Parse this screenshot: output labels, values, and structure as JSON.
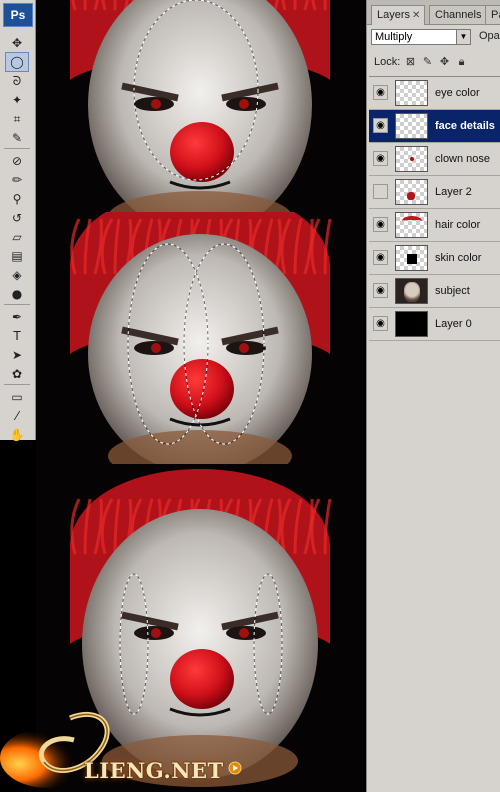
{
  "app": {
    "logo": "Ps"
  },
  "toolbar": {
    "tools": [
      {
        "name": "move-tool",
        "glyph": "✥"
      },
      {
        "name": "elliptical-marquee-tool",
        "glyph": "◯",
        "active": true
      },
      {
        "name": "lasso-tool",
        "glyph": "ᘐ"
      },
      {
        "name": "magic-wand-tool",
        "glyph": "✦"
      },
      {
        "name": "crop-tool",
        "glyph": "⌗"
      },
      {
        "name": "eyedropper-tool",
        "glyph": "✎"
      },
      {
        "name": "healing-brush-tool",
        "glyph": "⊘"
      },
      {
        "name": "brush-tool",
        "glyph": "✏"
      },
      {
        "name": "clone-stamp-tool",
        "glyph": "⚲"
      },
      {
        "name": "history-brush-tool",
        "glyph": "↺"
      },
      {
        "name": "eraser-tool",
        "glyph": "▱"
      },
      {
        "name": "gradient-tool",
        "glyph": "▤"
      },
      {
        "name": "blur-tool",
        "glyph": "◈"
      },
      {
        "name": "dodge-tool",
        "glyph": "●"
      },
      {
        "name": "pen-tool",
        "glyph": "✒"
      },
      {
        "name": "type-tool",
        "glyph": "T"
      },
      {
        "name": "path-selection-tool",
        "glyph": "➤"
      },
      {
        "name": "custom-shape-tool",
        "glyph": "✿"
      },
      {
        "name": "notes-tool",
        "glyph": "▭"
      },
      {
        "name": "color-sampler-tool",
        "glyph": "⁄"
      },
      {
        "name": "hand-tool",
        "glyph": "✋"
      }
    ]
  },
  "layers_panel": {
    "tabs": [
      {
        "label": "Layers",
        "active": true,
        "closable": true
      },
      {
        "label": "Channels",
        "active": false,
        "closable": false
      },
      {
        "label": "Pa",
        "active": false,
        "closable": false
      }
    ],
    "blend_mode": "Multiply",
    "opacity_label": "Opac",
    "lock_label": "Lock:",
    "lock_icons": [
      "transparent-pixels-lock-icon",
      "brush-lock-icon",
      "move-lock-icon",
      "padlock-icon"
    ],
    "layers": [
      {
        "name": "eye color",
        "visible": true,
        "selected": false,
        "thumb": "transparent"
      },
      {
        "name": "face details",
        "visible": true,
        "selected": true,
        "thumb": "transparent"
      },
      {
        "name": "clown nose",
        "visible": true,
        "selected": false,
        "thumb": "nose"
      },
      {
        "name": "Layer 2",
        "visible": false,
        "selected": false,
        "thumb": "red-spot"
      },
      {
        "name": "hair color",
        "visible": true,
        "selected": false,
        "thumb": "hair"
      },
      {
        "name": "skin color",
        "visible": true,
        "selected": false,
        "thumb": "square"
      },
      {
        "name": "subject",
        "visible": true,
        "selected": false,
        "thumb": "photo"
      },
      {
        "name": "Layer 0",
        "visible": true,
        "selected": false,
        "thumb": "black"
      }
    ]
  },
  "watermark": {
    "text": "LIENG.NET"
  },
  "colors": {
    "selection_bg": "#0a246a",
    "panel_bg": "#d6d3ce",
    "hair": "#c4141c",
    "nose": "#d0101a"
  }
}
